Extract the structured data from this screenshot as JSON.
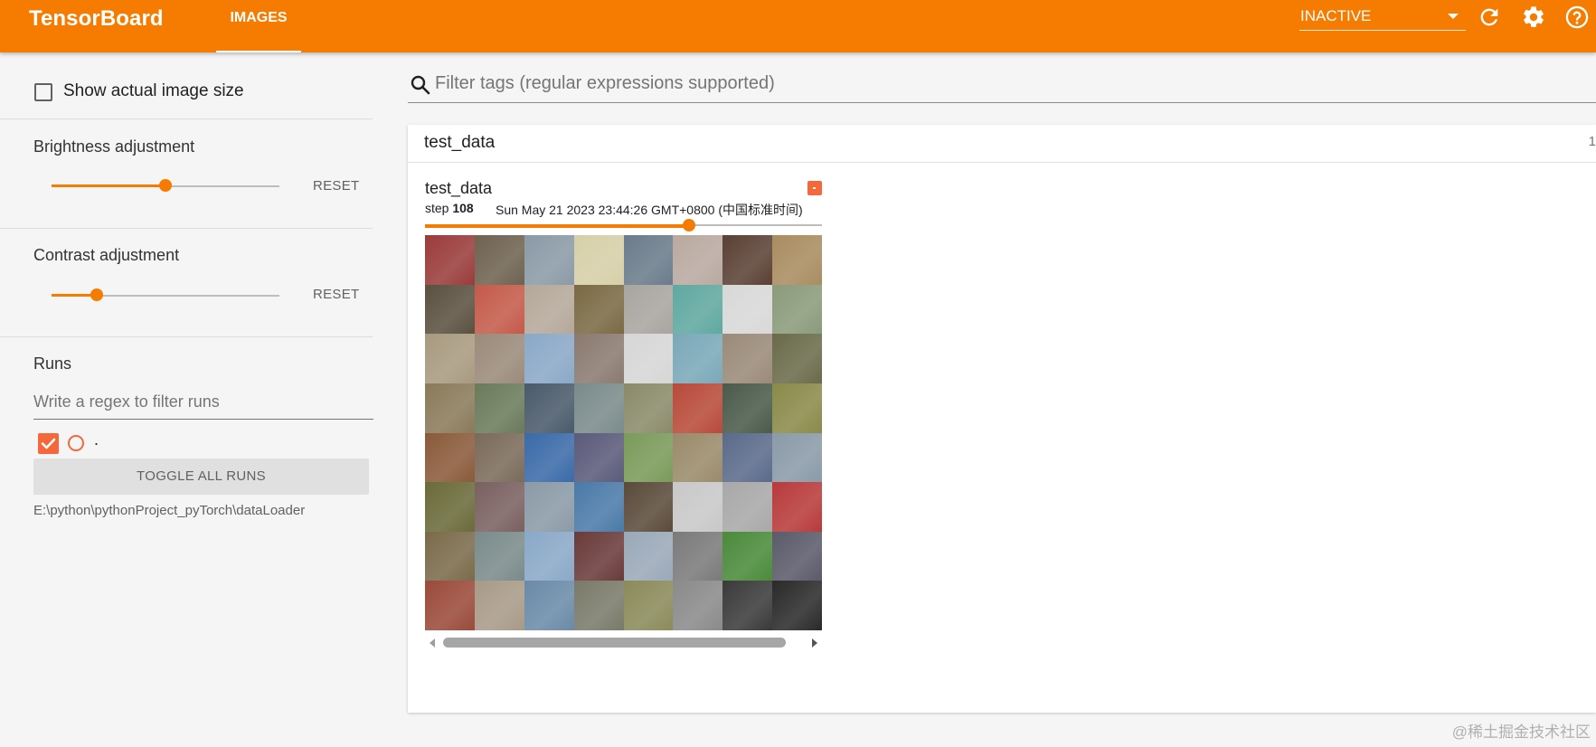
{
  "topbar": {
    "brand": "TensorBoard",
    "tab_label": "IMAGES",
    "run_selector": "INACTIVE",
    "icons": [
      "refresh-icon",
      "gear-icon",
      "help-icon"
    ]
  },
  "sidebar": {
    "show_actual_size_label": "Show actual image size",
    "brightness": {
      "title": "Brightness adjustment",
      "value": 0.5,
      "reset_label": "RESET"
    },
    "contrast": {
      "title": "Contrast adjustment",
      "value": 0.2,
      "reset_label": "RESET"
    },
    "runs": {
      "title": "Runs",
      "filter_placeholder": "Write a regex to filter runs",
      "items": [
        {
          "name": ".",
          "checked": true,
          "color": "#f4683c"
        }
      ],
      "toggle_label": "TOGGLE ALL RUNS",
      "logdir": "E:\\python\\pythonProject_pyTorch\\dataLoader"
    }
  },
  "main": {
    "filter_placeholder": "Filter tags (regular expressions supported)",
    "panel": {
      "title": "test_data",
      "count": "1",
      "card": {
        "tag": "test_data",
        "step_prefix": "step",
        "step": "108",
        "timestamp": "Sun May 21 2023 23:44:26 GMT+0800 (中国标准时间)",
        "step_progress": 0.66
      }
    }
  },
  "watermark": "@稀土掘金技术社区",
  "colors": {
    "accent": "#f57c00",
    "run": "#f4683c"
  },
  "thumbnails": [
    "#9a3b3b",
    "#6e6250",
    "#8a9aa6",
    "#d6cfa8",
    "#6a7b8a",
    "#b9a9a0",
    "#5a4034",
    "#a98c60",
    "#5a5040",
    "#c45a4a",
    "#b5a89a",
    "#7a6a44",
    "#a8a5a0",
    "#5fa8a0",
    "#d8d8d8",
    "#8a9a7a",
    "#a89a80",
    "#9a8a7a",
    "#8aa8c8",
    "#8a7a70",
    "#d6d6d6",
    "#7aa8b8",
    "#9a8a78",
    "#6a6a4a",
    "#8a7a5a",
    "#6a7a5a",
    "#4a5a6a",
    "#7a8a8a",
    "#8a8a6a",
    "#b84a3a",
    "#4a5a4a",
    "#8a8a4a",
    "#8a5a3a",
    "#7a6a5a",
    "#3a6aa8",
    "#5a5a7a",
    "#7a9a5a",
    "#9a8a6a",
    "#5a6a8a",
    "#8a9aa8",
    "#6a6a3a",
    "#7a6060",
    "#8a9aa6",
    "#4a7aa8",
    "#5a4a3a",
    "#c8c8c8",
    "#a8a8a8",
    "#b83a3a",
    "#7a6a4a",
    "#7a8a8a",
    "#8aa8c8",
    "#6a3a3a",
    "#9aa8b8",
    "#7a7a7a",
    "#4a8a3a",
    "#5a5a6a",
    "#9a4a3a",
    "#a89a88",
    "#6a8aa8",
    "#7a7a6a",
    "#8a8a5a",
    "#8a8a8a",
    "#3a3a3a",
    "#2a2a2a"
  ]
}
